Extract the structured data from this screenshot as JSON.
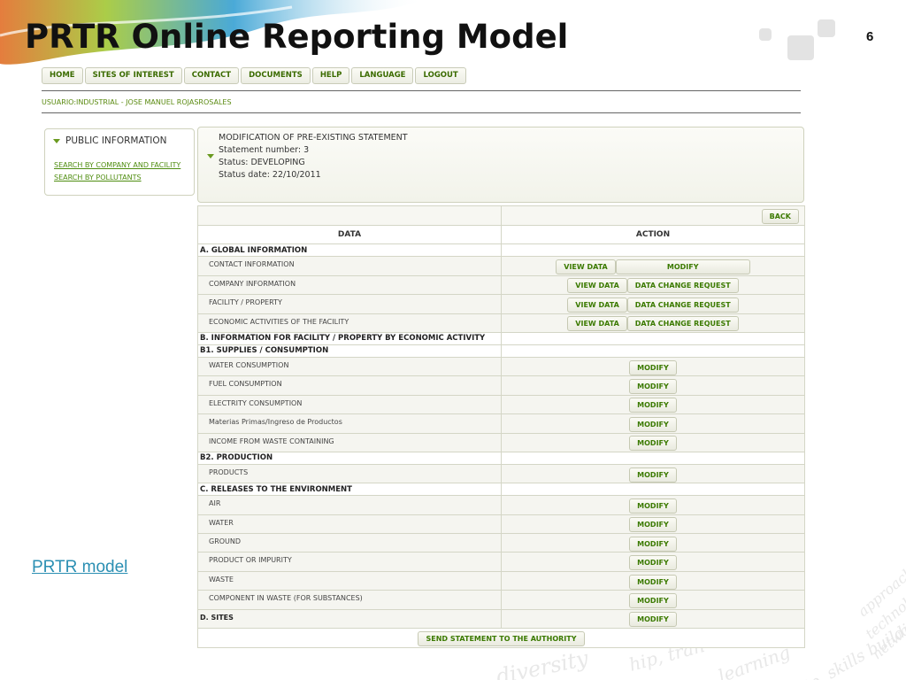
{
  "slide": {
    "title": "PRTR Online Reporting Model",
    "number": "6",
    "link": "PRTR model"
  },
  "nav": [
    "HOME",
    "SITES OF INTEREST",
    "CONTACT",
    "DOCUMENTS",
    "HELP",
    "LANGUAGE",
    "LOGOUT"
  ],
  "user_line": "USUARIO:INDUSTRIAL - JOSE MANUEL ROJASROSALES",
  "left_panel": {
    "heading": "PUBLIC INFORMATION",
    "links": [
      "SEARCH BY COMPANY AND FACILITY",
      "SEARCH BY POLLUTANTS"
    ]
  },
  "statement": {
    "title": "MODIFICATION OF PRE-EXISTING STATEMENT",
    "number": "Statement number: 3",
    "status": "Status: DEVELOPING",
    "date": "Status date: 22/10/2011"
  },
  "table": {
    "back": "BACK",
    "col_data": "DATA",
    "col_action": "ACTION",
    "rows": [
      {
        "kind": "section",
        "label": "A. GLOBAL INFORMATION"
      },
      {
        "kind": "item",
        "label": "CONTACT INFORMATION",
        "buttons": [
          "VIEW DATA",
          "MODIFY"
        ],
        "wide": true
      },
      {
        "kind": "item",
        "label": "COMPANY INFORMATION",
        "buttons": [
          "VIEW DATA",
          "DATA CHANGE REQUEST"
        ]
      },
      {
        "kind": "item",
        "label": "FACILITY / PROPERTY",
        "buttons": [
          "VIEW DATA",
          "DATA CHANGE REQUEST"
        ]
      },
      {
        "kind": "item",
        "label": "ECONOMIC ACTIVITIES OF THE FACILITY",
        "buttons": [
          "VIEW DATA",
          "DATA CHANGE REQUEST"
        ]
      },
      {
        "kind": "section",
        "label": "B. INFORMATION FOR FACILITY / PROPERTY BY ECONOMIC ACTIVITY"
      },
      {
        "kind": "section",
        "label": "B1. SUPPLIES / CONSUMPTION"
      },
      {
        "kind": "item",
        "label": "WATER CONSUMPTION",
        "buttons": [
          "MODIFY"
        ]
      },
      {
        "kind": "item",
        "label": "FUEL CONSUMPTION",
        "buttons": [
          "MODIFY"
        ]
      },
      {
        "kind": "item",
        "label": "ELECTRITY CONSUMPTION",
        "buttons": [
          "MODIFY"
        ]
      },
      {
        "kind": "item",
        "label": "Materias Primas/Ingreso de Productos",
        "buttons": [
          "MODIFY"
        ]
      },
      {
        "kind": "item",
        "label": "INCOME FROM WASTE CONTAINING",
        "buttons": [
          "MODIFY"
        ]
      },
      {
        "kind": "section",
        "label": "B2. PRODUCTION"
      },
      {
        "kind": "item",
        "label": "PRODUCTS",
        "buttons": [
          "MODIFY"
        ]
      },
      {
        "kind": "section",
        "label": "C. RELEASES TO THE ENVIRONMENT"
      },
      {
        "kind": "item",
        "label": "AIR",
        "buttons": [
          "MODIFY"
        ]
      },
      {
        "kind": "item",
        "label": "WATER",
        "buttons": [
          "MODIFY"
        ]
      },
      {
        "kind": "item",
        "label": "GROUND",
        "buttons": [
          "MODIFY"
        ]
      },
      {
        "kind": "item",
        "label": "PRODUCT OR IMPURITY",
        "buttons": [
          "MODIFY"
        ]
      },
      {
        "kind": "item",
        "label": "WASTE",
        "buttons": [
          "MODIFY"
        ]
      },
      {
        "kind": "item",
        "label": "COMPONENT IN WASTE (FOR SUBSTANCES)",
        "buttons": [
          "MODIFY"
        ]
      },
      {
        "kind": "item",
        "label": "D. SITES",
        "buttons": [
          "MODIFY"
        ],
        "bold": true
      }
    ],
    "send": "SEND STATEMENT TO THE AUTHORITY"
  }
}
